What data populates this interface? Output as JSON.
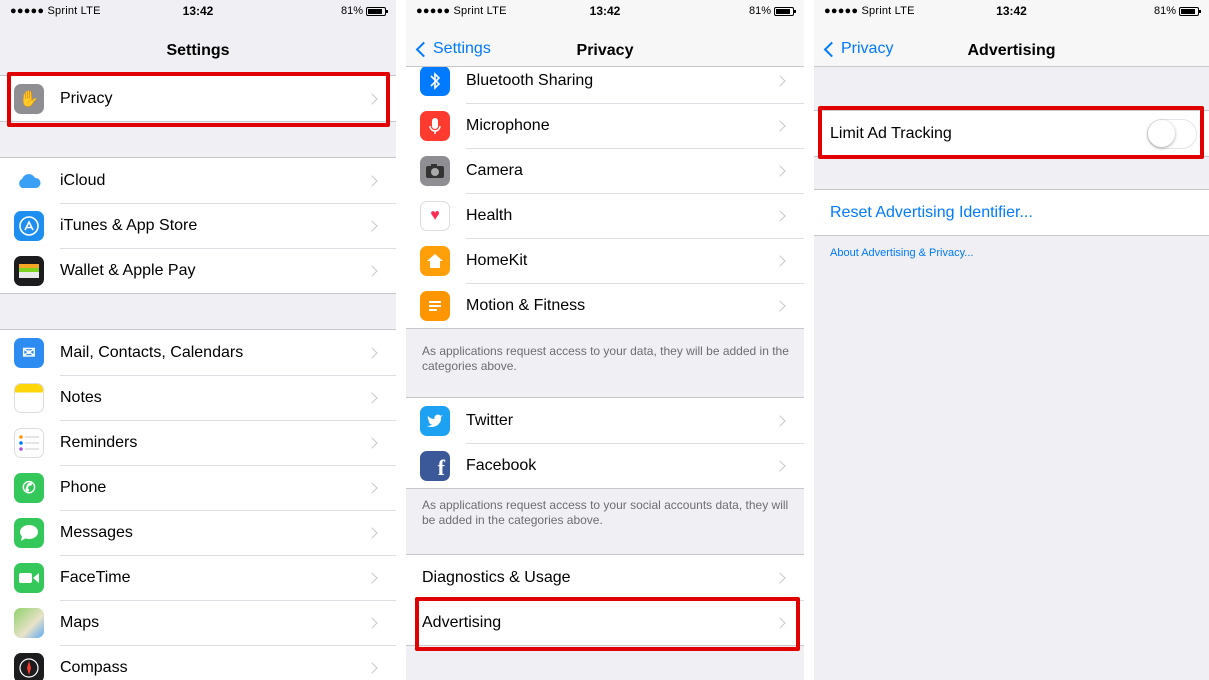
{
  "status": {
    "carrier": "●●●●● Sprint  LTE",
    "time": "13:42",
    "battery": "81%"
  },
  "screen1": {
    "title": "Settings",
    "group1": [
      {
        "label": "Privacy",
        "icon": "privacy-hand-icon",
        "color": "#8e8e93"
      }
    ],
    "group2": [
      {
        "label": "iCloud",
        "icon": "icloud-icon",
        "color": "#ffffff"
      },
      {
        "label": "iTunes & App Store",
        "icon": "app-store-icon",
        "color": "#1e8ff0"
      },
      {
        "label": "Wallet & Apple Pay",
        "icon": "wallet-icon",
        "color": "#1c1c1e"
      }
    ],
    "group3": [
      {
        "label": "Mail, Contacts, Calendars",
        "icon": "mail-icon",
        "color": "#2c8cf2"
      },
      {
        "label": "Notes",
        "icon": "notes-icon",
        "color": "#ffd60a"
      },
      {
        "label": "Reminders",
        "icon": "reminders-icon",
        "color": "#ffffff"
      },
      {
        "label": "Phone",
        "icon": "phone-icon",
        "color": "#34c759"
      },
      {
        "label": "Messages",
        "icon": "messages-icon",
        "color": "#34c759"
      },
      {
        "label": "FaceTime",
        "icon": "facetime-icon",
        "color": "#34c759"
      },
      {
        "label": "Maps",
        "icon": "maps-icon",
        "color": "#8fd16a"
      },
      {
        "label": "Compass",
        "icon": "compass-icon",
        "color": "#1c1c1e"
      }
    ]
  },
  "screen2": {
    "title": "Privacy",
    "back": "Settings",
    "group1": [
      {
        "label": "Bluetooth Sharing",
        "icon": "bluetooth-icon",
        "color": "#007aff"
      },
      {
        "label": "Microphone",
        "icon": "microphone-icon",
        "color": "#ff3b30"
      },
      {
        "label": "Camera",
        "icon": "camera-icon",
        "color": "#8e8e93"
      },
      {
        "label": "Health",
        "icon": "health-icon",
        "color": "#ffffff"
      },
      {
        "label": "HomeKit",
        "icon": "homekit-icon",
        "color": "#ff9f0a"
      },
      {
        "label": "Motion & Fitness",
        "icon": "motion-fitness-icon",
        "color": "#ff9500"
      }
    ],
    "footer1": "As applications request access to your data, they will be added in the categories above.",
    "group2": [
      {
        "label": "Twitter",
        "icon": "twitter-icon",
        "color": "#1da1f2"
      },
      {
        "label": "Facebook",
        "icon": "facebook-icon",
        "color": "#3b5998"
      }
    ],
    "footer2": "As applications request access to your social accounts data, they will be added in the categories above.",
    "group3": [
      {
        "label": "Diagnostics & Usage"
      },
      {
        "label": "Advertising"
      }
    ]
  },
  "screen3": {
    "title": "Advertising",
    "back": "Privacy",
    "toggle_label": "Limit Ad Tracking",
    "toggle_on": false,
    "reset_label": "Reset Advertising Identifier...",
    "about_link": "About Advertising & Privacy..."
  }
}
